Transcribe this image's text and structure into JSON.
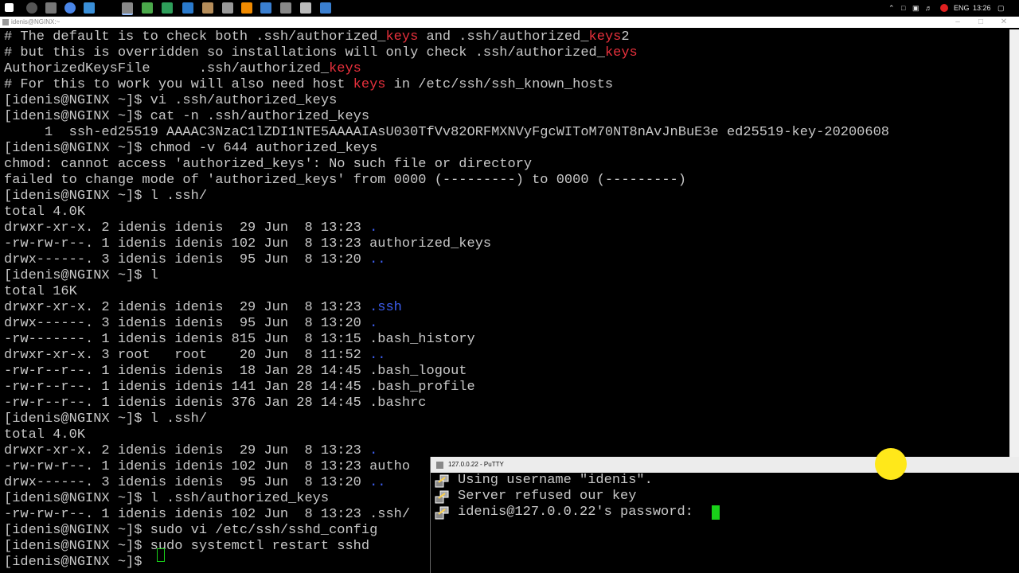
{
  "taskbar": {
    "language": "ENG",
    "time": "13:26"
  },
  "main_window": {
    "title": "idenis@NGINX:~"
  },
  "terminal_lines": [
    [
      {
        "t": "# The default is to check both .ssh/authorized_"
      },
      {
        "t": "keys",
        "c": "red"
      },
      {
        "t": " and .ssh/authorized_"
      },
      {
        "t": "keys",
        "c": "red"
      },
      {
        "t": "2"
      }
    ],
    [
      {
        "t": "# but this is overridden so installations will only check .ssh/authorized_"
      },
      {
        "t": "keys",
        "c": "red"
      }
    ],
    [
      {
        "t": "AuthorizedKeysFile      .ssh/authorized_"
      },
      {
        "t": "keys",
        "c": "red"
      }
    ],
    [
      {
        "t": "# For this to work you will also need host "
      },
      {
        "t": "keys",
        "c": "red"
      },
      {
        "t": " in /etc/ssh/ssh_known_hosts"
      }
    ],
    [
      {
        "t": "[idenis@NGINX ~]$ vi .ssh/authorized_keys"
      }
    ],
    [
      {
        "t": "[idenis@NGINX ~]$ cat -n .ssh/authorized_keys"
      }
    ],
    [
      {
        "t": "     1  ssh-ed25519 AAAAC3NzaC1lZDI1NTE5AAAAIAsU030TfVv82ORFMXNVyFgcWIToM70NT8nAvJnBuE3e ed25519-key-20200608"
      }
    ],
    [
      {
        "t": "[idenis@NGINX ~]$ chmod -v 644 authorized_keys"
      }
    ],
    [
      {
        "t": "chmod: cannot access 'authorized_keys': No such file or directory"
      }
    ],
    [
      {
        "t": "failed to change mode of 'authorized_keys' from 0000 (---------) to 0000 (---------)"
      }
    ],
    [
      {
        "t": "[idenis@NGINX ~]$ l .ssh/"
      }
    ],
    [
      {
        "t": "total 4.0K"
      }
    ],
    [
      {
        "t": "drwxr-xr-x. 2 idenis idenis  29 Jun  8 13:23 "
      },
      {
        "t": ".",
        "c": "blue"
      }
    ],
    [
      {
        "t": "-rw-rw-r--. 1 idenis idenis 102 Jun  8 13:23 authorized_keys"
      }
    ],
    [
      {
        "t": "drwx------. 3 idenis idenis  95 Jun  8 13:20 "
      },
      {
        "t": "..",
        "c": "blue"
      }
    ],
    [
      {
        "t": "[idenis@NGINX ~]$ l"
      }
    ],
    [
      {
        "t": "total 16K"
      }
    ],
    [
      {
        "t": "drwxr-xr-x. 2 idenis idenis  29 Jun  8 13:23 "
      },
      {
        "t": ".ssh",
        "c": "blue"
      }
    ],
    [
      {
        "t": "drwx------. 3 idenis idenis  95 Jun  8 13:20 "
      },
      {
        "t": ".",
        "c": "blue"
      }
    ],
    [
      {
        "t": "-rw-------. 1 idenis idenis 815 Jun  8 13:15 .bash_history"
      }
    ],
    [
      {
        "t": "drwxr-xr-x. 3 root   root    20 Jun  8 11:52 "
      },
      {
        "t": "..",
        "c": "blue"
      }
    ],
    [
      {
        "t": "-rw-r--r--. 1 idenis idenis  18 Jan 28 14:45 .bash_logout"
      }
    ],
    [
      {
        "t": "-rw-r--r--. 1 idenis idenis 141 Jan 28 14:45 .bash_profile"
      }
    ],
    [
      {
        "t": "-rw-r--r--. 1 idenis idenis 376 Jan 28 14:45 .bashrc"
      }
    ],
    [
      {
        "t": "[idenis@NGINX ~]$ l .ssh/"
      }
    ],
    [
      {
        "t": "total 4.0K"
      }
    ],
    [
      {
        "t": "drwxr-xr-x. 2 idenis idenis  29 Jun  8 13:23 "
      },
      {
        "t": ".",
        "c": "blue"
      }
    ],
    [
      {
        "t": "-rw-rw-r--. 1 idenis idenis 102 Jun  8 13:23 autho"
      }
    ],
    [
      {
        "t": "drwx------. 3 idenis idenis  95 Jun  8 13:20 "
      },
      {
        "t": "..",
        "c": "blue"
      }
    ],
    [
      {
        "t": "[idenis@NGINX ~]$ l .ssh/authorized_keys"
      }
    ],
    [
      {
        "t": "-rw-rw-r--. 1 idenis idenis 102 Jun  8 13:23 .ssh/"
      }
    ],
    [
      {
        "t": "[idenis@NGINX ~]$ sudo vi /etc/ssh/sshd_config"
      }
    ],
    [
      {
        "t": "[idenis@NGINX ~]$ sudo systemctl restart sshd"
      }
    ],
    [
      {
        "t": "[idenis@NGINX ~]$ "
      }
    ]
  ],
  "putty2": {
    "title": "127.0.0.22 - PuTTY",
    "lines": [
      "Using username \"idenis\".",
      "Server refused our key",
      "idenis@127.0.0.22's password: "
    ]
  },
  "colors": {
    "red": "#e8303c",
    "blue": "#3d5ef0",
    "cursor": "#19d219",
    "highlight": "#ffe81a"
  }
}
